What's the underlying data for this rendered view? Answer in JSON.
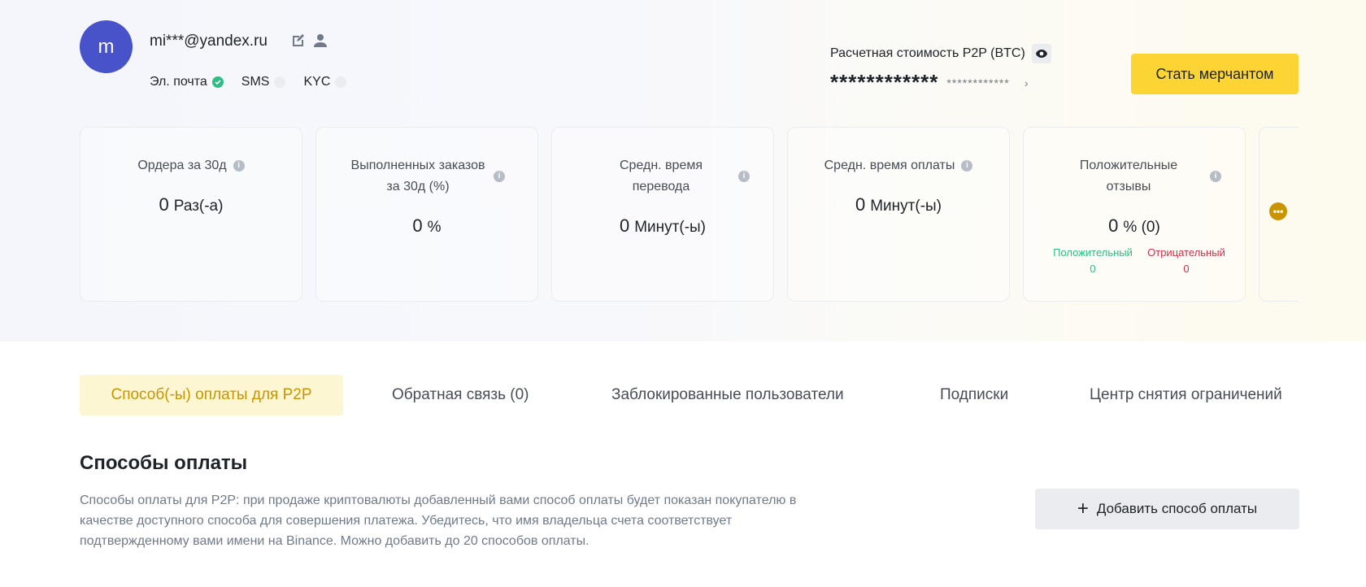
{
  "profile": {
    "avatar_letter": "m",
    "email": "mi***@yandex.ru",
    "verifications": [
      {
        "label": "Эл. почта",
        "verified": true
      },
      {
        "label": "SMS",
        "verified": false
      },
      {
        "label": "KYC",
        "verified": false
      }
    ]
  },
  "p2p_value": {
    "label": "Расчетная стоимость P2P (BTC)",
    "masked_big": "************",
    "masked_small": "************",
    "arrow": "›"
  },
  "merchant_button": "Стать мерчантом",
  "stats": [
    {
      "title": "Ордера за 30д",
      "value": "0",
      "unit": "Раз(-а)"
    },
    {
      "title": "Выполненных заказов за 30д (%)",
      "value": "0",
      "unit": "%"
    },
    {
      "title": "Средн. время перевода",
      "value": "0",
      "unit": "Минут(-ы)"
    },
    {
      "title": "Средн. время оплаты",
      "value": "0",
      "unit": "Минут(-ы)"
    },
    {
      "title": "Положительные отзывы",
      "value": "0",
      "unit": "% (0)",
      "positive_label": "Положительный",
      "positive_count": "0",
      "negative_label": "Отрицательный",
      "negative_count": "0"
    }
  ],
  "tabs": [
    "Способ(-ы) оплаты для P2P",
    "Обратная связь (0)",
    "Заблокированные пользователи",
    "Подписки",
    "Центр снятия ограничений"
  ],
  "section": {
    "title": "Способы оплаты",
    "description": "Способы оплаты для P2P: при продаже криптовалюты добавленный вами способ оплаты будет показан покупателю в качестве доступного способа для совершения платежа. Убедитесь, что имя владельца счета соответствует подтвержденному вами имени на Binance. Можно добавить до 20 способов оплаты.",
    "add_button": "Добавить способ оплаты"
  },
  "colors": {
    "accent": "#fcd535",
    "accent_text": "#c99400",
    "avatar": "#4852c9",
    "positive": "#2ebd85",
    "negative": "#cf304a"
  }
}
